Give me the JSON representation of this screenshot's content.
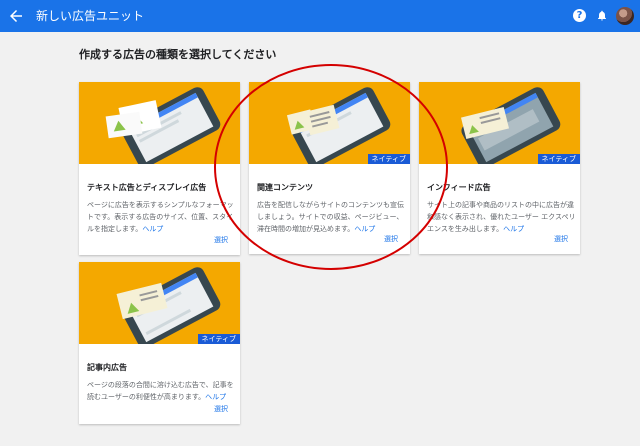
{
  "topbar": {
    "title": "新しい広告ユニット",
    "back_icon": "arrow-back-icon",
    "help_icon": "help-icon",
    "help_glyph": "?",
    "bell_icon": "bell-icon"
  },
  "heading": "作成する広告の種類を選択してください",
  "cards": [
    {
      "title": "テキスト広告とディスプレイ広告",
      "desc": "ページに広告を表示するシンプルなフォーマットです。表示する広告のサイズ、位置、スタイルを指定します。",
      "help": "ヘルプ",
      "select": "選択",
      "badge": ""
    },
    {
      "title": "関連コンテンツ",
      "desc": "広告を配信しながらサイトのコンテンツも宣伝しましょう。サイトでの収益、ページビュー、滞在時間の増加が見込めます。",
      "help": "ヘルプ",
      "select": "選択",
      "badge": "ネイティブ"
    },
    {
      "title": "インフィード広告",
      "desc": "サイト上の記事や商品のリストの中に広告が違和感なく表示され、優れたユーザー エクスペリエンスを生み出します。",
      "help": "ヘルプ",
      "select": "選択",
      "badge": "ネイティブ"
    },
    {
      "title": "記事内広告",
      "desc": "ページの段落の合間に溶け込む広告で、記事を読むユーザーの利便性が高まります。",
      "help": "ヘルプ",
      "select": "選択",
      "badge": "ネイティブ"
    }
  ],
  "colors": {
    "topbar": "#1a73e8",
    "card_art": "#f4a800",
    "badge": "#1a5bd6",
    "annotation": "#d40000"
  }
}
